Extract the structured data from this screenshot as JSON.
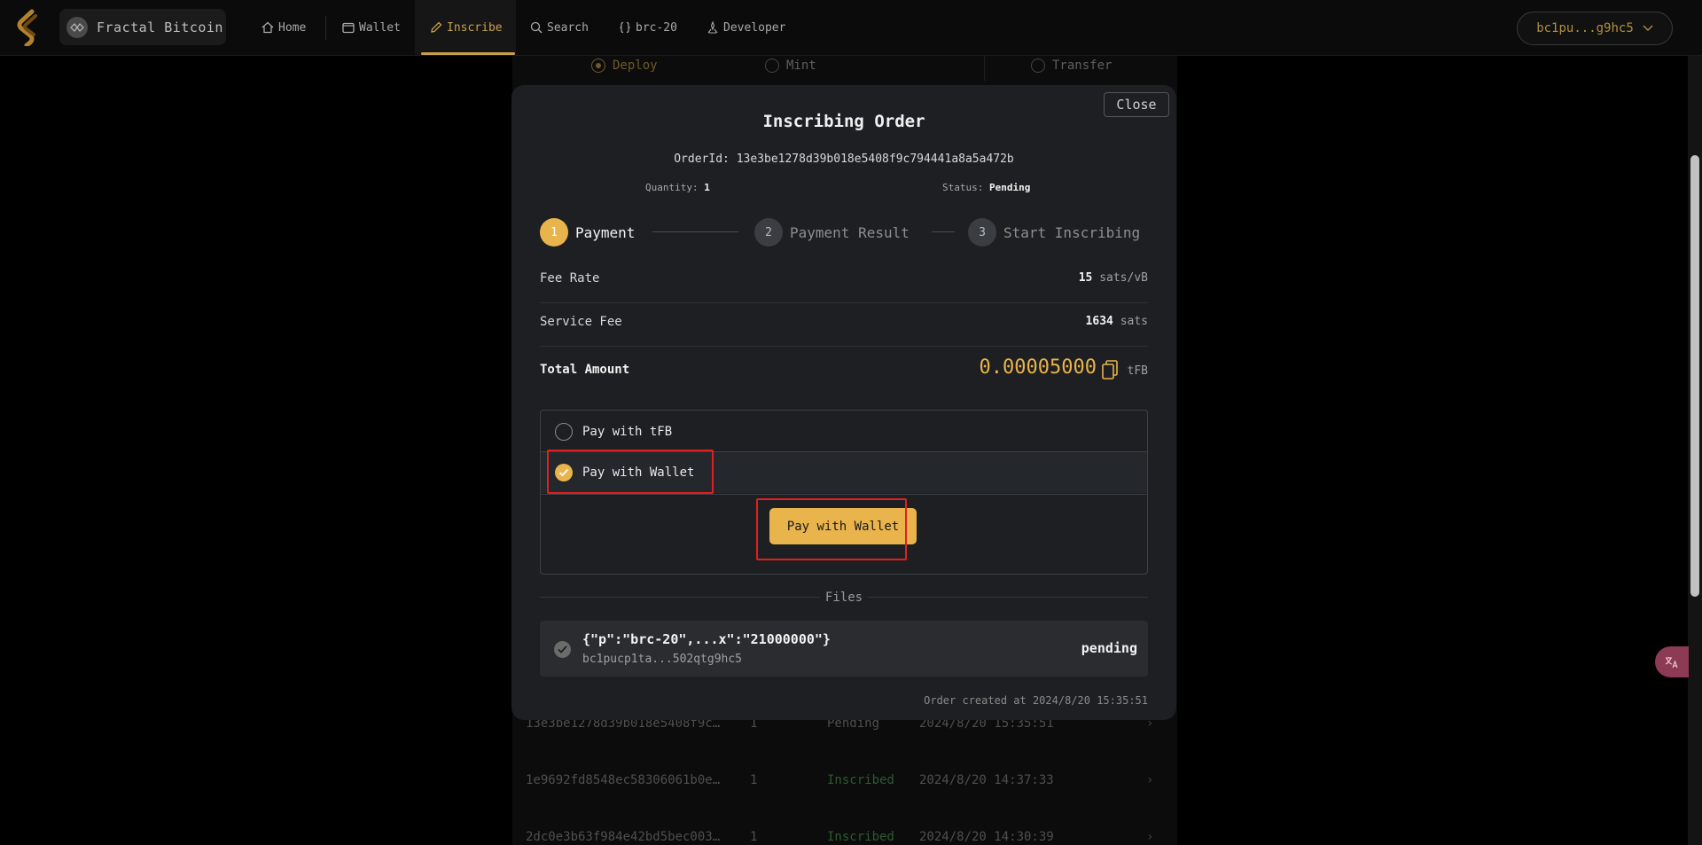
{
  "header": {
    "network_label": "Fractal Bitcoin",
    "nav": [
      {
        "label": "Home",
        "icon": "home-icon"
      },
      {
        "label": "Wallet",
        "icon": "wallet-icon"
      },
      {
        "label": "Inscribe",
        "icon": "pencil-icon",
        "active": true
      },
      {
        "label": "Search",
        "icon": "search-icon"
      },
      {
        "label": "brc-20",
        "icon": "braces-icon"
      },
      {
        "label": "Developer",
        "icon": "developer-icon"
      }
    ],
    "wallet_address": "bc1pu...g9hc5"
  },
  "background": {
    "tabs": [
      {
        "label": "Deploy",
        "selected": true
      },
      {
        "label": "Mint",
        "selected": false
      },
      {
        "label": "Transfer",
        "selected": false
      }
    ],
    "orders": [
      {
        "id": "13e3be1278d39b018e5408f9c…",
        "qty": "1",
        "status": "Pending",
        "time": "2024/8/20 15:35:51"
      },
      {
        "id": "1e9692fd8548ec58306061b0e…",
        "qty": "1",
        "status": "Inscribed",
        "time": "2024/8/20 14:37:33"
      },
      {
        "id": "2dc0e3b63f984e42bd5bec003…",
        "qty": "1",
        "status": "Inscribed",
        "time": "2024/8/20 14:30:39"
      }
    ]
  },
  "modal": {
    "close_label": "Close",
    "title": "Inscribing Order",
    "order_id_label": "OrderId:",
    "order_id": "13e3be1278d39b018e5408f9c794441a8a5a472b",
    "quantity_label": "Quantity:",
    "quantity": "1",
    "status_label": "Status:",
    "status": "Pending",
    "steps": [
      {
        "num": "1",
        "label": "Payment",
        "active": true
      },
      {
        "num": "2",
        "label": "Payment Result",
        "active": false
      },
      {
        "num": "3",
        "label": "Start Inscribing",
        "active": false
      }
    ],
    "fee_rate_label": "Fee Rate",
    "fee_rate_value": "15",
    "fee_rate_unit": "sats/vB",
    "service_fee_label": "Service Fee",
    "service_fee_value": "1634",
    "service_fee_unit": "sats",
    "total_label": "Total Amount",
    "total_value": "0.00005000",
    "total_unit": "tFB",
    "pay_options": [
      {
        "label": "Pay with tFB",
        "selected": false
      },
      {
        "label": "Pay with Wallet",
        "selected": true
      }
    ],
    "pay_button": "Pay with Wallet",
    "files_label": "Files",
    "file": {
      "name": "{\"p\":\"brc-20\",...x\":\"21000000\"}",
      "address": "bc1pucp1ta...502qtg9hc5",
      "status": "pending"
    },
    "created_text": "Order created at 2024/8/20 15:35:51"
  },
  "colors": {
    "accent": "#e9b44c",
    "highlight": "#e02020",
    "modal_bg": "#1d1f22"
  }
}
